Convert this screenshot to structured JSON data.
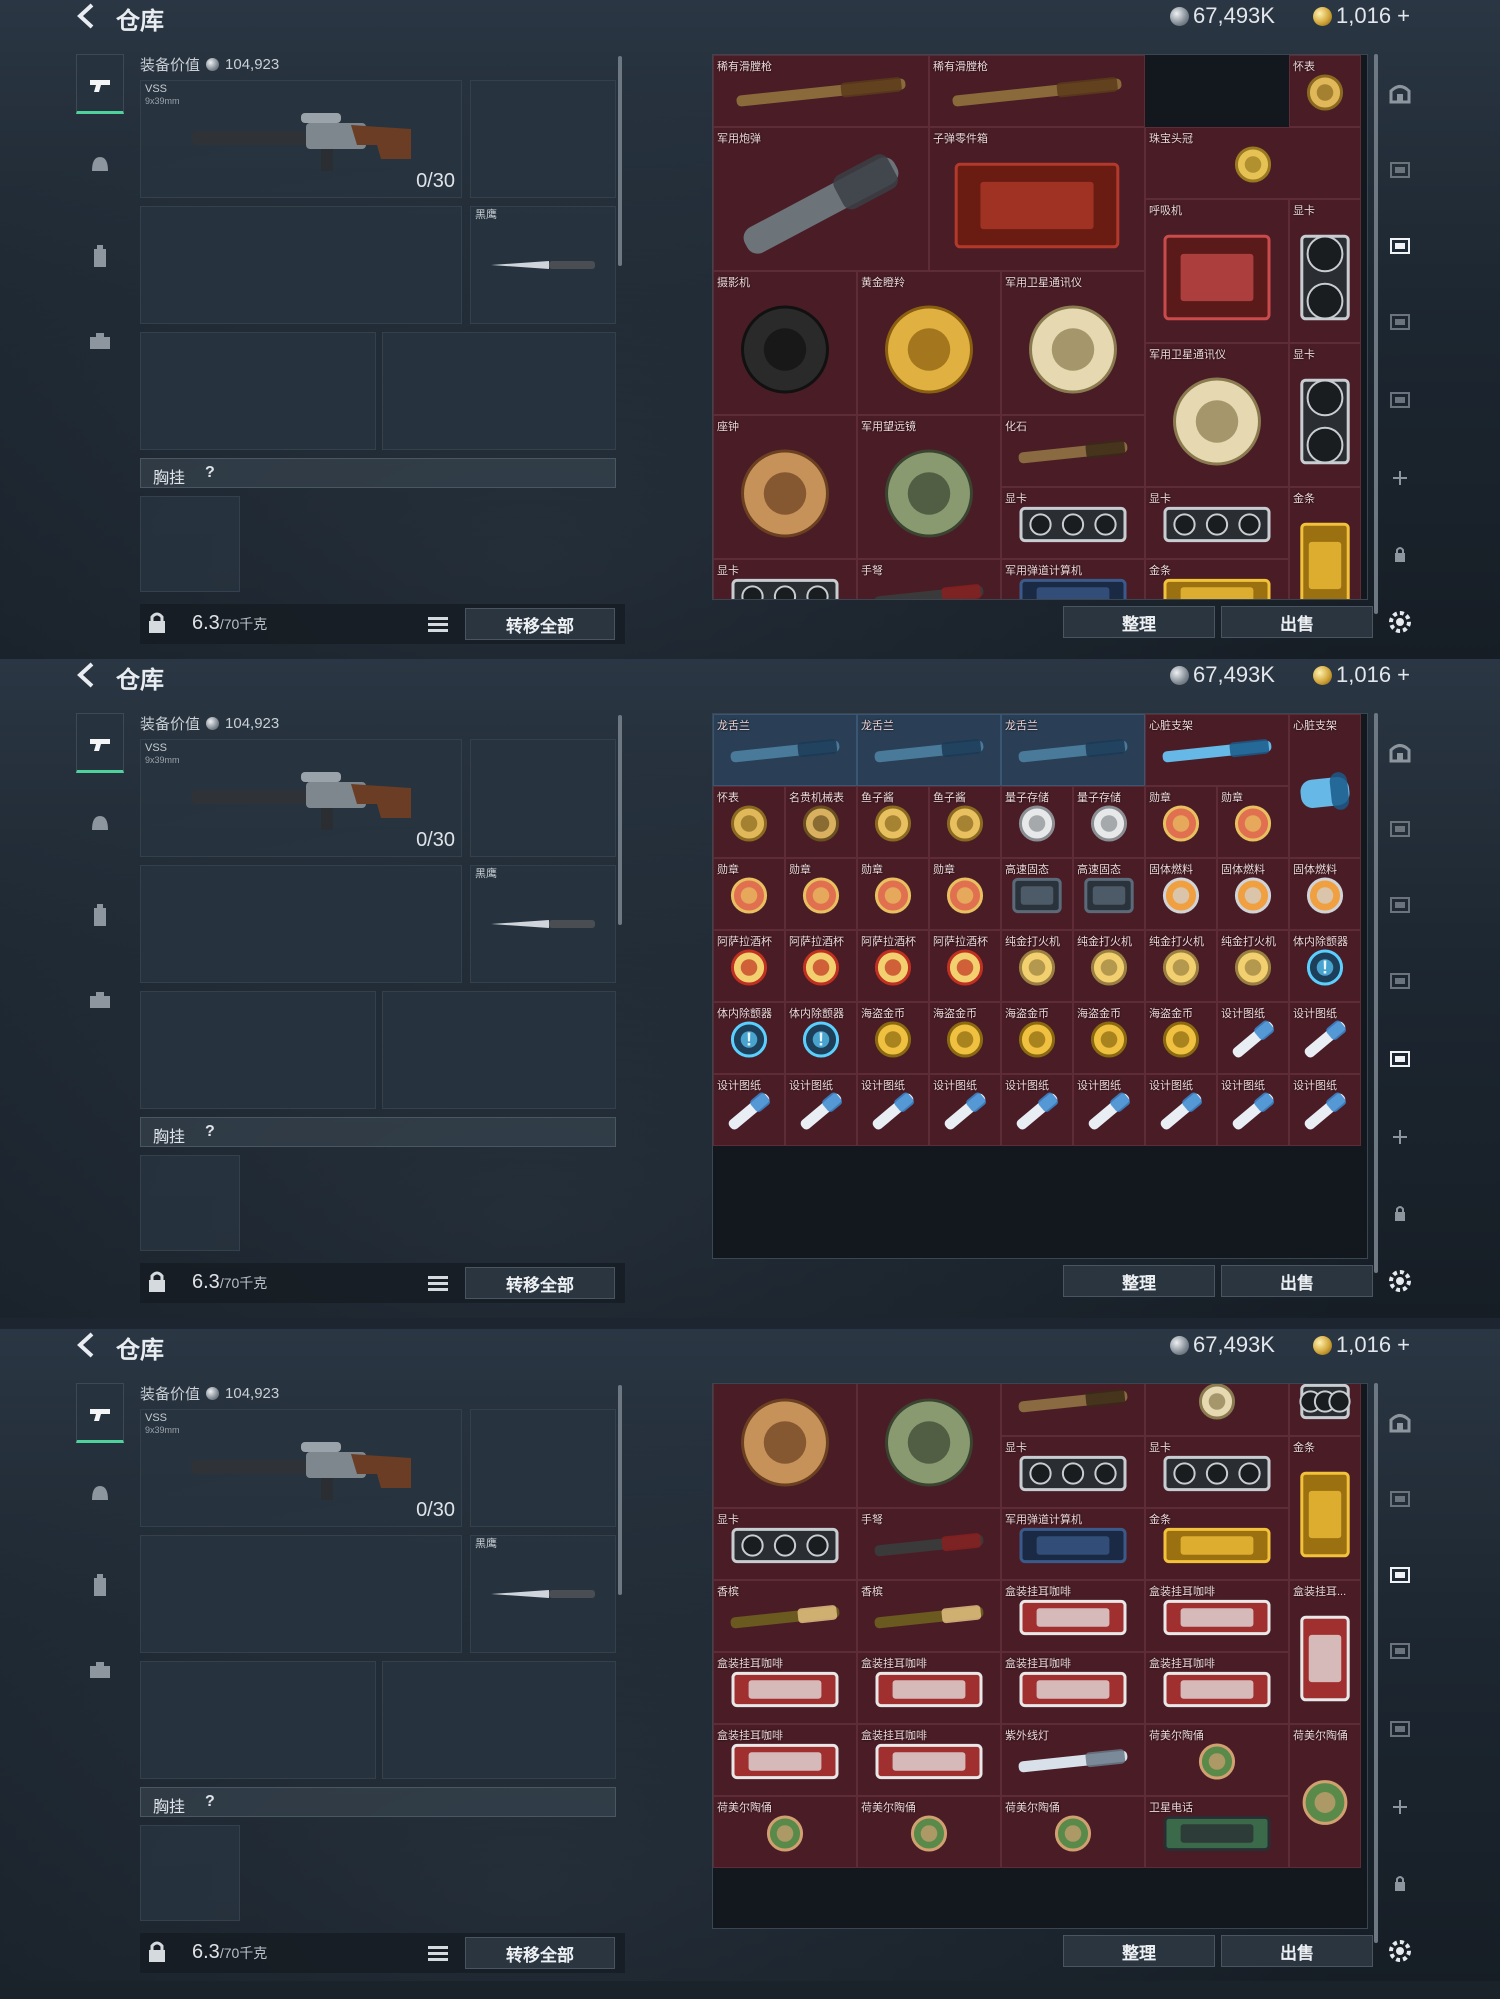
{
  "header": {
    "title": "仓库",
    "silver_amount": "67,493K",
    "gold_amount": "1,016",
    "gold_plus": "+"
  },
  "loadout": {
    "value_label": "装备价值",
    "value_amount": "104,923",
    "weapon_name": "VSS",
    "weapon_caliber": "9x39mm",
    "ammo_count": "0/30",
    "knife_name": "黑鹰",
    "chest_rig_label": "胸挂",
    "chest_rig_help": "?",
    "weight_value": "6.3",
    "weight_unit": "/70千克",
    "transfer_all": "转移全部"
  },
  "warehouse": {
    "sort_label": "整理",
    "sell_label": "出售"
  },
  "colors": {
    "item_bg": "#4a1d26",
    "item_bg_blue": "#2a3f56",
    "accent_green": "#4fd19b"
  },
  "screens": [
    {
      "items": [
        {
          "label": "稀有滑膛枪",
          "icon": "musket-icon",
          "col": 1,
          "row": 1,
          "w": 3,
          "h": 1
        },
        {
          "label": "稀有滑膛枪",
          "icon": "musket-icon",
          "col": 4,
          "row": 1,
          "w": 3,
          "h": 1
        },
        {
          "label": "怀表",
          "icon": "pocket-watch-icon",
          "col": 9,
          "row": 1,
          "w": 1,
          "h": 1
        },
        {
          "label": "军用炮弹",
          "icon": "missile-icon",
          "col": 1,
          "row": 2,
          "w": 3,
          "h": 2
        },
        {
          "label": "子弹零件箱",
          "icon": "parts-crate-icon",
          "col": 4,
          "row": 2,
          "w": 3,
          "h": 2
        },
        {
          "label": "珠宝头冠",
          "icon": "crown-icon",
          "col": 7,
          "row": 2,
          "w": 3,
          "h": 1
        },
        {
          "label": "呼吸机",
          "icon": "ventilator-icon",
          "col": 7,
          "row": 3,
          "w": 2,
          "h": 2
        },
        {
          "label": "显卡",
          "icon": "gpu-icon",
          "col": 9,
          "row": 3,
          "w": 1,
          "h": 2
        },
        {
          "label": "摄影机",
          "icon": "camera-icon",
          "col": 1,
          "row": 4,
          "w": 2,
          "h": 2
        },
        {
          "label": "黄金瞪羚",
          "icon": "gazelle-icon",
          "col": 3,
          "row": 4,
          "w": 2,
          "h": 2
        },
        {
          "label": "军用卫星通讯仪",
          "icon": "satellite-dish-icon",
          "col": 5,
          "row": 4,
          "w": 2,
          "h": 2
        },
        {
          "label": "军用卫星通讯仪",
          "icon": "satellite-dish-icon",
          "col": 7,
          "row": 5,
          "w": 2,
          "h": 2
        },
        {
          "label": "显卡",
          "icon": "gpu-icon",
          "col": 9,
          "row": 5,
          "w": 1,
          "h": 2
        },
        {
          "label": "座钟",
          "icon": "clock-icon",
          "col": 1,
          "row": 6,
          "w": 2,
          "h": 2
        },
        {
          "label": "军用望远镜",
          "icon": "binoculars-icon",
          "col": 3,
          "row": 6,
          "w": 2,
          "h": 2
        },
        {
          "label": "化石",
          "icon": "fossil-icon",
          "col": 5,
          "row": 6,
          "w": 2,
          "h": 1
        },
        {
          "label": "显卡",
          "icon": "gpu-icon",
          "col": 5,
          "row": 7,
          "w": 2,
          "h": 1
        },
        {
          "label": "显卡",
          "icon": "gpu-icon",
          "col": 7,
          "row": 7,
          "w": 2,
          "h": 1
        },
        {
          "label": "金条",
          "icon": "gold-bar-icon",
          "col": 9,
          "row": 7,
          "w": 1,
          "h": 2
        },
        {
          "label": "显卡",
          "icon": "gpu-icon",
          "col": 1,
          "row": 8,
          "w": 2,
          "h": 1
        },
        {
          "label": "手弩",
          "icon": "crossbow-icon",
          "col": 3,
          "row": 8,
          "w": 2,
          "h": 1
        },
        {
          "label": "军用弹道计算机",
          "icon": "ballistic-computer-icon",
          "col": 5,
          "row": 8,
          "w": 2,
          "h": 1
        },
        {
          "label": "金条",
          "icon": "gold-bar-icon",
          "col": 7,
          "row": 8,
          "w": 2,
          "h": 1
        }
      ]
    },
    {
      "items": [
        {
          "label": "龙舌兰",
          "icon": "bottle-icon",
          "col": 1,
          "row": 1,
          "w": 2,
          "h": 1,
          "blue": true
        },
        {
          "label": "龙舌兰",
          "icon": "bottle-icon",
          "col": 3,
          "row": 1,
          "w": 2,
          "h": 1,
          "blue": true
        },
        {
          "label": "龙舌兰",
          "icon": "bottle-icon",
          "col": 5,
          "row": 1,
          "w": 2,
          "h": 1,
          "blue": true
        },
        {
          "label": "心脏支架",
          "icon": "stent-icon",
          "col": 7,
          "row": 1,
          "w": 2,
          "h": 1
        },
        {
          "label": "心脏支架",
          "icon": "stent-icon",
          "col": 9,
          "row": 1,
          "w": 1,
          "h": 2
        },
        {
          "label": "怀表",
          "icon": "pocket-watch-icon",
          "col": 1,
          "row": 2
        },
        {
          "label": "名贵机械表",
          "icon": "wristwatch-icon",
          "col": 2,
          "row": 2
        },
        {
          "label": "鱼子酱",
          "icon": "caviar-icon",
          "col": 3,
          "row": 2
        },
        {
          "label": "鱼子酱",
          "icon": "caviar-icon",
          "col": 4,
          "row": 2
        },
        {
          "label": "量子存储",
          "icon": "usb-icon",
          "col": 5,
          "row": 2
        },
        {
          "label": "量子存储",
          "icon": "usb-icon",
          "col": 6,
          "row": 2
        },
        {
          "label": "勋章",
          "icon": "medal-icon",
          "col": 7,
          "row": 2
        },
        {
          "label": "勋章",
          "icon": "medal-icon",
          "col": 8,
          "row": 2
        },
        {
          "label": "勋章",
          "icon": "medal-icon",
          "col": 1,
          "row": 3
        },
        {
          "label": "勋章",
          "icon": "medal-icon",
          "col": 2,
          "row": 3
        },
        {
          "label": "勋章",
          "icon": "medal-icon",
          "col": 3,
          "row": 3
        },
        {
          "label": "勋章",
          "icon": "medal-icon",
          "col": 4,
          "row": 3
        },
        {
          "label": "高速固态",
          "icon": "ssd-icon",
          "col": 5,
          "row": 3
        },
        {
          "label": "高速固态",
          "icon": "ssd-icon",
          "col": 6,
          "row": 3
        },
        {
          "label": "固体燃料",
          "icon": "fuel-icon",
          "col": 7,
          "row": 3
        },
        {
          "label": "固体燃料",
          "icon": "fuel-icon",
          "col": 8,
          "row": 3
        },
        {
          "label": "固体燃料",
          "icon": "fuel-icon",
          "col": 9,
          "row": 3
        },
        {
          "label": "阿萨拉酒杯",
          "icon": "goblet-icon",
          "col": 1,
          "row": 4
        },
        {
          "label": "阿萨拉酒杯",
          "icon": "goblet-icon",
          "col": 2,
          "row": 4
        },
        {
          "label": "阿萨拉酒杯",
          "icon": "goblet-icon",
          "col": 3,
          "row": 4
        },
        {
          "label": "阿萨拉酒杯",
          "icon": "goblet-icon",
          "col": 4,
          "row": 4
        },
        {
          "label": "纯金打火机",
          "icon": "lighter-icon",
          "col": 5,
          "row": 4
        },
        {
          "label": "纯金打火机",
          "icon": "lighter-icon",
          "col": 6,
          "row": 4
        },
        {
          "label": "纯金打火机",
          "icon": "lighter-icon",
          "col": 7,
          "row": 4
        },
        {
          "label": "纯金打火机",
          "icon": "lighter-icon",
          "col": 8,
          "row": 4
        },
        {
          "label": "体内除颤器",
          "icon": "defibrillator-icon",
          "col": 9,
          "row": 4
        },
        {
          "label": "体内除颤器",
          "icon": "defibrillator-icon",
          "col": 1,
          "row": 5
        },
        {
          "label": "体内除颤器",
          "icon": "defibrillator-icon",
          "col": 2,
          "row": 5
        },
        {
          "label": "海盗金币",
          "icon": "gold-coin-icon",
          "col": 3,
          "row": 5
        },
        {
          "label": "海盗金币",
          "icon": "gold-coin-icon",
          "col": 4,
          "row": 5
        },
        {
          "label": "海盗金币",
          "icon": "gold-coin-icon",
          "col": 5,
          "row": 5
        },
        {
          "label": "海盗金币",
          "icon": "gold-coin-icon",
          "col": 6,
          "row": 5
        },
        {
          "label": "海盗金币",
          "icon": "gold-coin-icon",
          "col": 7,
          "row": 5
        },
        {
          "label": "设计图纸",
          "icon": "blueprint-icon",
          "col": 8,
          "row": 5
        },
        {
          "label": "设计图纸",
          "icon": "blueprint-icon",
          "col": 9,
          "row": 5
        },
        {
          "label": "设计图纸",
          "icon": "blueprint-icon",
          "col": 1,
          "row": 6
        },
        {
          "label": "设计图纸",
          "icon": "blueprint-icon",
          "col": 2,
          "row": 6
        },
        {
          "label": "设计图纸",
          "icon": "blueprint-icon",
          "col": 3,
          "row": 6
        },
        {
          "label": "设计图纸",
          "icon": "blueprint-icon",
          "col": 4,
          "row": 6
        },
        {
          "label": "设计图纸",
          "icon": "blueprint-icon",
          "col": 5,
          "row": 6
        },
        {
          "label": "设计图纸",
          "icon": "blueprint-icon",
          "col": 6,
          "row": 6
        },
        {
          "label": "设计图纸",
          "icon": "blueprint-icon",
          "col": 7,
          "row": 6
        },
        {
          "label": "设计图纸",
          "icon": "blueprint-icon",
          "col": 8,
          "row": 6
        },
        {
          "label": "设计图纸",
          "icon": "blueprint-icon",
          "col": 9,
          "row": 6
        }
      ]
    },
    {
      "items": [
        {
          "label": "",
          "icon": "gpu-icon",
          "col": 9,
          "row": 1,
          "w": 1,
          "h": 1
        },
        {
          "label": "座钟",
          "icon": "clock-icon",
          "col": 1,
          "row": 1,
          "w": 2,
          "h": 2
        },
        {
          "label": "军用望远镜",
          "icon": "binoculars-icon",
          "col": 3,
          "row": 1,
          "w": 2,
          "h": 2
        },
        {
          "label": "化石",
          "icon": "fossil-icon",
          "col": 5,
          "row": 1,
          "w": 2,
          "h": 1
        },
        {
          "label": "",
          "icon": "satellite-dish-icon",
          "col": 7,
          "row": 1,
          "w": 2,
          "h": 1
        },
        {
          "label": "显卡",
          "icon": "gpu-icon",
          "col": 5,
          "row": 2,
          "w": 2,
          "h": 1
        },
        {
          "label": "显卡",
          "icon": "gpu-icon",
          "col": 7,
          "row": 2,
          "w": 2,
          "h": 1
        },
        {
          "label": "金条",
          "icon": "gold-bar-icon",
          "col": 9,
          "row": 2,
          "w": 1,
          "h": 2
        },
        {
          "label": "显卡",
          "icon": "gpu-icon",
          "col": 1,
          "row": 3,
          "w": 2,
          "h": 1
        },
        {
          "label": "手弩",
          "icon": "crossbow-icon",
          "col": 3,
          "row": 3,
          "w": 2,
          "h": 1
        },
        {
          "label": "军用弹道计算机",
          "icon": "ballistic-computer-icon",
          "col": 5,
          "row": 3,
          "w": 2,
          "h": 1
        },
        {
          "label": "金条",
          "icon": "gold-bar-icon",
          "col": 7,
          "row": 3,
          "w": 2,
          "h": 1
        },
        {
          "label": "香槟",
          "icon": "champagne-icon",
          "col": 1,
          "row": 4,
          "w": 2,
          "h": 1
        },
        {
          "label": "香槟",
          "icon": "champagne-icon",
          "col": 3,
          "row": 4,
          "w": 2,
          "h": 1
        },
        {
          "label": "盒装挂耳咖啡",
          "icon": "coffee-box-icon",
          "col": 5,
          "row": 4,
          "w": 2,
          "h": 1
        },
        {
          "label": "盒装挂耳咖啡",
          "icon": "coffee-box-icon",
          "col": 7,
          "row": 4,
          "w": 2,
          "h": 1
        },
        {
          "label": "盒装挂耳...",
          "icon": "coffee-box-icon",
          "col": 9,
          "row": 4,
          "w": 1,
          "h": 2
        },
        {
          "label": "盒装挂耳咖啡",
          "icon": "coffee-box-icon",
          "col": 1,
          "row": 5,
          "w": 2,
          "h": 1
        },
        {
          "label": "盒装挂耳咖啡",
          "icon": "coffee-box-icon",
          "col": 3,
          "row": 5,
          "w": 2,
          "h": 1
        },
        {
          "label": "盒装挂耳咖啡",
          "icon": "coffee-box-icon",
          "col": 5,
          "row": 5,
          "w": 2,
          "h": 1
        },
        {
          "label": "盒装挂耳咖啡",
          "icon": "coffee-box-icon",
          "col": 7,
          "row": 5,
          "w": 2,
          "h": 1
        },
        {
          "label": "盒装挂耳咖啡",
          "icon": "coffee-box-icon",
          "col": 1,
          "row": 6,
          "w": 2,
          "h": 1
        },
        {
          "label": "盒装挂耳咖啡",
          "icon": "coffee-box-icon",
          "col": 3,
          "row": 6,
          "w": 2,
          "h": 1
        },
        {
          "label": "紫外线灯",
          "icon": "uv-lamp-icon",
          "col": 5,
          "row": 6,
          "w": 2,
          "h": 1
        },
        {
          "label": "荷美尔陶俑",
          "icon": "figurine-icon",
          "col": 7,
          "row": 6,
          "w": 2,
          "h": 1
        },
        {
          "label": "荷美尔陶俑",
          "icon": "figurine-icon",
          "col": 9,
          "row": 6,
          "w": 1,
          "h": 2
        },
        {
          "label": "荷美尔陶俑",
          "icon": "figurine-icon",
          "col": 1,
          "row": 7,
          "w": 2,
          "h": 1
        },
        {
          "label": "荷美尔陶俑",
          "icon": "figurine-icon",
          "col": 3,
          "row": 7,
          "w": 2,
          "h": 1
        },
        {
          "label": "荷美尔陶俑",
          "icon": "figurine-icon",
          "col": 5,
          "row": 7,
          "w": 2,
          "h": 1
        },
        {
          "label": "卫星电话",
          "icon": "sat-phone-icon",
          "col": 7,
          "row": 7,
          "w": 2,
          "h": 1
        }
      ]
    }
  ]
}
